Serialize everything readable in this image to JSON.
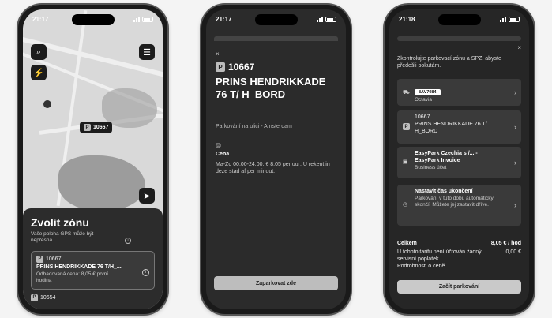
{
  "phone1": {
    "time": "21:17",
    "pin_label": "10667",
    "sheet_title": "Zvolit zónu",
    "gps_note": "Vaše poloha GPS může být nepřesná",
    "zone_card": {
      "code": "10667",
      "name": "PRINS HENDRIKKADE 76 T/H_...",
      "estimate": "Odhadovaná cena: 8,05 € první hodina"
    },
    "next_zone": "10654"
  },
  "phone2": {
    "time": "21:17",
    "close": "×",
    "zone_code": "10667",
    "zone_name": "PRINS HENDRIKKADE 76 T/ H_BORD",
    "subtitle": "Parkování na ulici - Amsterdam",
    "price_label": "Cena",
    "price_text": "Ma-Zo 00:00-24:00; € 8,05 per uur; U rekent in deze stad af per minuut.",
    "button": "Zaparkovat zde"
  },
  "phone3": {
    "time": "21:18",
    "close": "×",
    "intro": "Zkontrolujte parkovací zónu a SPZ, abyste předešli pokutám.",
    "vehicle": {
      "plate": "8AV7084",
      "model": "Octavia"
    },
    "zone": {
      "code": "10667",
      "name": "PRINS HENDRIKKADE 76 T/ H_BORD"
    },
    "payment": {
      "line1": "EasyPark Czechia s /... -",
      "line2": "EasyPark Invoice",
      "line3": "Business účet"
    },
    "end_time": {
      "title": "Nastavit čas ukončení",
      "text": "Parkování v tuto dobu automaticky skončí. Můžete jej zastavit dříve."
    },
    "total_label": "Celkem",
    "total_value": "8,05 € / hod",
    "fee_note": "U tohoto tarifu není účtován žádný servisní poplatek",
    "fee_value": "0,00 €",
    "details": "Podrobnosti o ceně",
    "button": "Začít parkování"
  }
}
